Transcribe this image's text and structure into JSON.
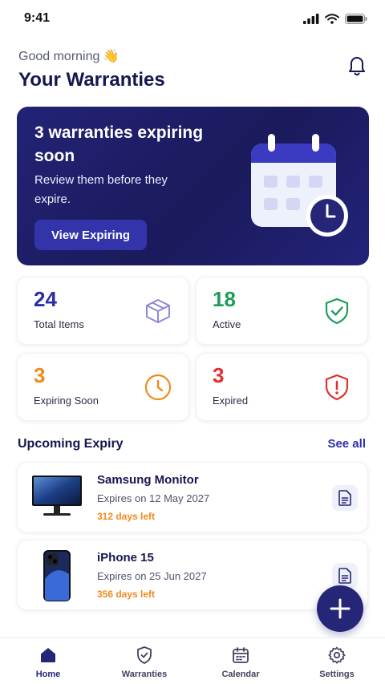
{
  "status": {
    "time": "9:41"
  },
  "header": {
    "greeting": "Good morning 👋",
    "title": "Your Warranties"
  },
  "hero": {
    "title": "3 warranties expiring soon",
    "subtitle": "Review them before they expire.",
    "button": "View Expiring"
  },
  "stats": [
    {
      "value": "24",
      "label": "Total Items",
      "color": "#2d2da8",
      "icon": "box-icon"
    },
    {
      "value": "18",
      "label": "Active",
      "color": "#1e9c5a",
      "icon": "shield-check-icon"
    },
    {
      "value": "3",
      "label": "Expiring Soon",
      "color": "#f08a1c",
      "icon": "clock-icon"
    },
    {
      "value": "3",
      "label": "Expired",
      "color": "#e0302f",
      "icon": "shield-alert-icon"
    }
  ],
  "upcoming": {
    "title": "Upcoming Expiry",
    "see_all": "See all",
    "items": [
      {
        "name": "Samsung Monitor",
        "expires": "Expires on 12 May 2027",
        "days_left": "312 days left",
        "icon": "monitor-icon"
      },
      {
        "name": "iPhone 15",
        "expires": "Expires on 25 Jun 2027",
        "days_left": "356 days left",
        "icon": "phone-icon"
      }
    ]
  },
  "tabs": [
    {
      "label": "Home",
      "icon": "home-icon",
      "active": true
    },
    {
      "label": "Warranties",
      "icon": "shield-tab-icon",
      "active": false
    },
    {
      "label": "Calendar",
      "icon": "calendar-icon",
      "active": false
    },
    {
      "label": "Settings",
      "icon": "gear-icon",
      "active": false
    }
  ],
  "colors": {
    "accent": "#262678",
    "warning": "#f08a1c"
  }
}
